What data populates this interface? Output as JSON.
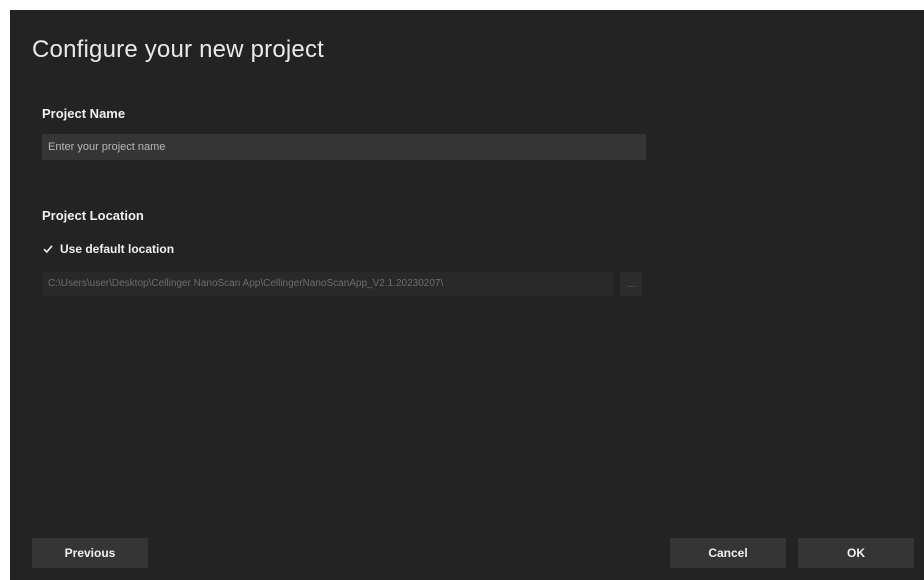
{
  "dialog": {
    "title": "Configure your new project"
  },
  "project_name": {
    "label": "Project Name",
    "value": "",
    "placeholder": "Enter your project name"
  },
  "project_location": {
    "label": "Project Location",
    "use_default_label": "Use default location",
    "use_default_checked": true,
    "path": "C:\\Users\\user\\Desktop\\Cellinger NanoScan App\\CellingerNanoScanApp_V2.1.20230207\\",
    "browse_label": "..."
  },
  "footer": {
    "previous_label": "Previous",
    "cancel_label": "Cancel",
    "ok_label": "OK"
  },
  "colors": {
    "background": "#232323",
    "input": "#353535",
    "button": "#353535",
    "text": "#f0f0f0"
  }
}
